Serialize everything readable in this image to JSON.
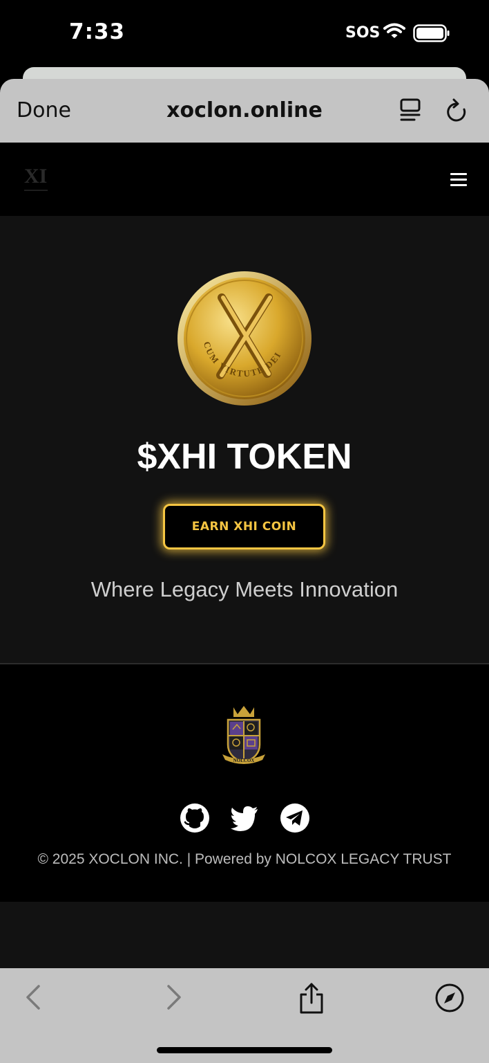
{
  "status_bar": {
    "time": "7:33",
    "carrier": "SOS"
  },
  "browser": {
    "done_label": "Done",
    "url": "xoclon.online"
  },
  "site": {
    "logo_text": "XI",
    "hero": {
      "title": "$XHI TOKEN",
      "cta_label": "EARN XHI COIN",
      "tagline": "Where Legacy Meets Innovation",
      "coin_inscription": "CUM VIRTUTE DEI"
    },
    "footer": {
      "crest_label": "NOLCOX",
      "copyright": "© 2025 XOCLON INC. | Powered by NOLCOX LEGACY TRUST",
      "social_links": [
        "github-icon",
        "twitter-icon",
        "telegram-icon"
      ]
    }
  },
  "colors": {
    "accent_gold": "#f5c542",
    "hero_bg": "#121212",
    "nav_bg": "#000000",
    "toolbar_bg": "#c4c4c4"
  }
}
